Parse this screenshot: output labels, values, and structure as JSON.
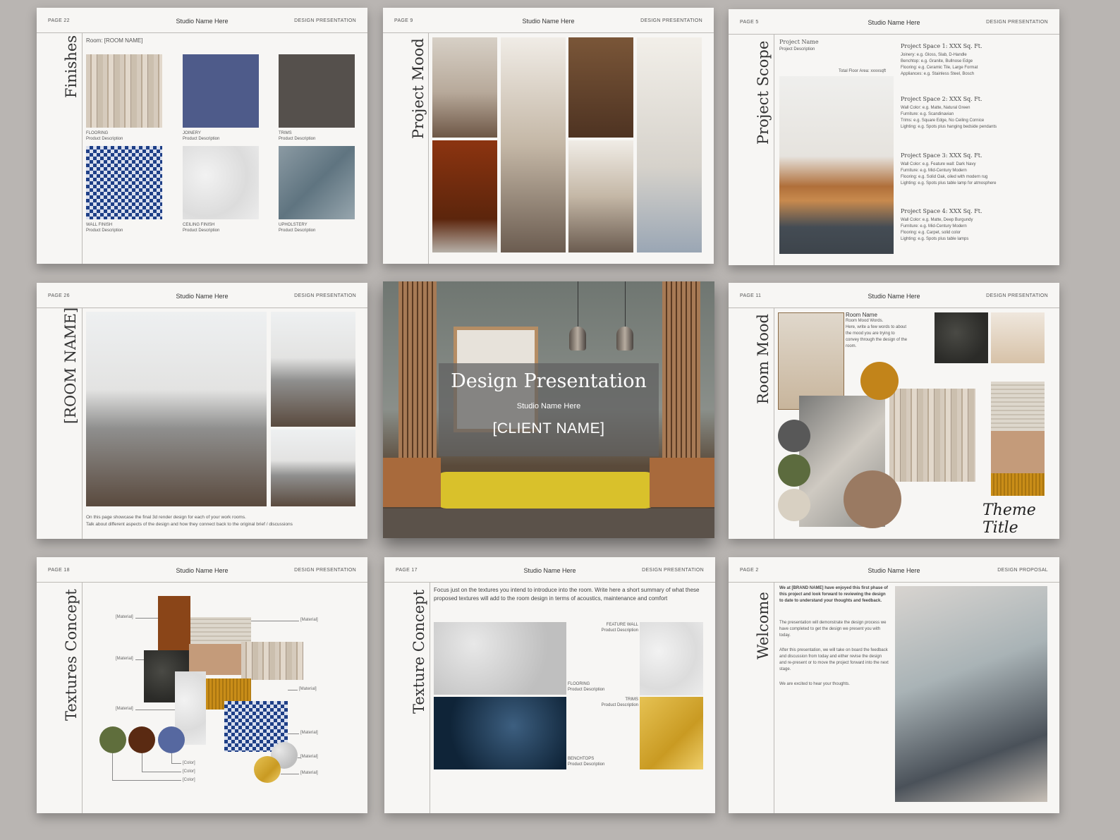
{
  "common": {
    "studio": "Studio Name Here",
    "type_presentation": "DESIGN PRESENTATION",
    "type_proposal": "DESIGN PROPOSAL"
  },
  "finishes": {
    "page": "PAGE 22",
    "title": "Finishes",
    "room": "Room: [ROOM NAME]",
    "swatches": [
      {
        "label": "FLOORING",
        "desc": "Product Description"
      },
      {
        "label": "JOINERY",
        "desc": "Product Description"
      },
      {
        "label": "TRIMS",
        "desc": "Product Description"
      },
      {
        "label": "WALL FINISH",
        "desc": "Product Description"
      },
      {
        "label": "CEILING FINISH",
        "desc": "Product Description"
      },
      {
        "label": "UPHOLSTERY",
        "desc": "Product Description"
      }
    ],
    "colors": {
      "joinery": "#4e5b8a",
      "trims": "#55504c"
    }
  },
  "project_mood": {
    "page": "PAGE 9",
    "title": "Project Mood"
  },
  "project_scope": {
    "page": "PAGE 5",
    "title": "Project Scope",
    "project_name": "Project Name",
    "project_desc": "Project Description",
    "floor_area": "Total Floor Area: xxxxsqft",
    "spaces": [
      {
        "title": "Project Space 1: XXX Sq. Ft.",
        "lines": [
          "Joinery: e.g. Gloss, Slab, D-Handle",
          "Benchtop: e.g. Granite, Bullnose Edge",
          "Flooring: e.g. Ceramic Tile, Large Format",
          "Appliances: e.g. Stainless Steel, Bosch"
        ]
      },
      {
        "title": "Project Space 2: XXX Sq. Ft.",
        "lines": [
          "Wall Color: e.g. Matte, Natural Green",
          "Furniture: e.g. Scandinavian",
          "Trims: e.g. Square Edge, No Ceiling Cornice",
          "Lighting: e.g. Spots plus hanging bedside pendants"
        ]
      },
      {
        "title": "Project Space 3: XXX Sq. Ft.",
        "lines": [
          "Wall Color: e.g. Feature wall: Dark Navy",
          "Furniture: e.g. Mid-Century Modern",
          "Flooring: e.g. Solid Oak, oiled with modern rug",
          "Lighting: e.g. Spots plus table lamp for atmosphere"
        ]
      },
      {
        "title": "Project Space 4: XXX Sq. Ft.",
        "lines": [
          "Wall Color: e.g. Matte, Deep Burgundy",
          "Furniture: e.g. Mid-Century Modern",
          "Flooring: e.g. Carpet, solid color",
          "Lighting: e.g. Spots plus table lamps"
        ]
      }
    ]
  },
  "room_name": {
    "page": "PAGE 26",
    "title": "[ROOM NAME]",
    "caption_1": "On this page showcase the final 3d render design for each of your work rooms.",
    "caption_2": "Talk about different aspects of the design and how they connect back to the original brief / discussions"
  },
  "cover": {
    "title": "Design Presentation",
    "studio": "Studio Name Here",
    "client": "[CLIENT NAME]"
  },
  "room_mood": {
    "page": "PAGE 11",
    "title": "Room Mood",
    "heading": "Room Name",
    "subheading": "Room Mood Words.",
    "body": "Here, write a few words to about the mood you are trying to convey through the design of the room.",
    "signature": "Theme Title",
    "colors": [
      "#585858",
      "#5c6b3e",
      "#d8d0c2",
      "#c2841a",
      "#9a7a62"
    ]
  },
  "textures_concept": {
    "page": "PAGE 18",
    "title": "Textures Concept",
    "material": "[Material]",
    "color": "[Color]",
    "colors": [
      "#5f6e3c",
      "#5a2a12",
      "#5668a0"
    ]
  },
  "texture_concept": {
    "page": "PAGE 17",
    "title": "Texture Concept",
    "intro": "Focus just on the textures you intend to introduce into the room. Write here a short summary of what these proposed textures will add to the room design in terms of acoustics, maintenance and comfort",
    "items": [
      {
        "label": "FEATURE WALL",
        "desc": "Product Description"
      },
      {
        "label": "FLOORING",
        "desc": "Product Description"
      },
      {
        "label": "TRIMS",
        "desc": "Product Description"
      },
      {
        "label": "BENCHTOPS",
        "desc": "Product Description"
      }
    ]
  },
  "welcome": {
    "page": "PAGE 2",
    "title": "Welcome",
    "lead": "We at [BRAND NAME] have enjoyed this first phase of this project and look forward to reviewing the design to date to understand your thoughts and feedback.",
    "p1": "The presentation will demonstrate the design process we have completed to get the design we present you with today.",
    "p2": "After this presentation, we will take on board the feedback and discussion from today and either revise the design and re-present or to move the project forward into the next stage.",
    "p3": "We are excited to hear your thoughts."
  }
}
